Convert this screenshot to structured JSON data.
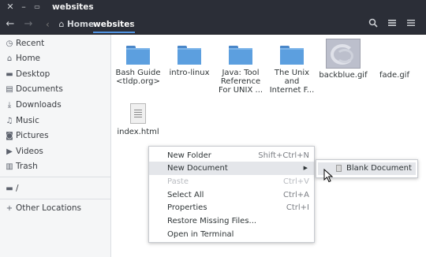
{
  "window": {
    "title": "websites",
    "controls": {
      "close_icon": "close-icon",
      "minimize_icon": "minimize-icon",
      "maximize_icon": "maximize-icon"
    }
  },
  "toolbar": {
    "path": [
      {
        "label": "Home",
        "icon": "home-icon"
      },
      {
        "label": "websites"
      }
    ]
  },
  "sidebar": {
    "items": [
      {
        "label": "Recent",
        "icon": "clock-icon"
      },
      {
        "label": "Home",
        "icon": "home-icon"
      },
      {
        "label": "Desktop",
        "icon": "desktop-icon"
      },
      {
        "label": "Documents",
        "icon": "documents-icon"
      },
      {
        "label": "Downloads",
        "icon": "download-icon"
      },
      {
        "label": "Music",
        "icon": "music-icon"
      },
      {
        "label": "Pictures",
        "icon": "camera-icon"
      },
      {
        "label": "Videos",
        "icon": "video-icon"
      },
      {
        "label": "Trash",
        "icon": "trash-icon"
      }
    ],
    "drive": {
      "label": "/",
      "icon": "drive-icon"
    },
    "other": {
      "label": "Other Locations",
      "icon": "plus-icon"
    }
  },
  "files": [
    {
      "line1": "Bash Guide",
      "line2": "<tldp.org>",
      "line3": "",
      "type": "folder"
    },
    {
      "line1": "intro-linux",
      "line2": "",
      "line3": "",
      "type": "folder"
    },
    {
      "line1": "Java: Tool",
      "line2": "Reference",
      "line3": "For UNIX ...",
      "type": "folder"
    },
    {
      "line1": "The Unix",
      "line2": "and",
      "line3": "Internet F...",
      "type": "folder"
    },
    {
      "line1": "backblue.gif",
      "line2": "",
      "line3": "",
      "type": "image"
    },
    {
      "line1": "fade.gif",
      "line2": "",
      "line3": "",
      "type": "image-blank"
    },
    {
      "line1": "index.html",
      "line2": "",
      "line3": "",
      "type": "document"
    }
  ],
  "context_menu": {
    "items": [
      {
        "label": "New Folder",
        "shortcut": "Shift+Ctrl+N"
      },
      {
        "label": "New Document",
        "shortcut": ""
      },
      {
        "label": "Paste",
        "shortcut": "Ctrl+V"
      },
      {
        "label": "Select All",
        "shortcut": "Ctrl+A"
      },
      {
        "label": "Properties",
        "shortcut": "Ctrl+I"
      },
      {
        "label": "Restore Missing Files...",
        "shortcut": ""
      },
      {
        "label": "Open in Terminal",
        "shortcut": ""
      }
    ]
  },
  "submenu": {
    "items": [
      {
        "label": "Blank Document",
        "icon": "document-icon"
      }
    ]
  },
  "colors": {
    "titlebar": "#2b2e37",
    "accent": "#5294e2",
    "folder": "#5c9fdf",
    "sidebar": "#f5f6f7"
  }
}
